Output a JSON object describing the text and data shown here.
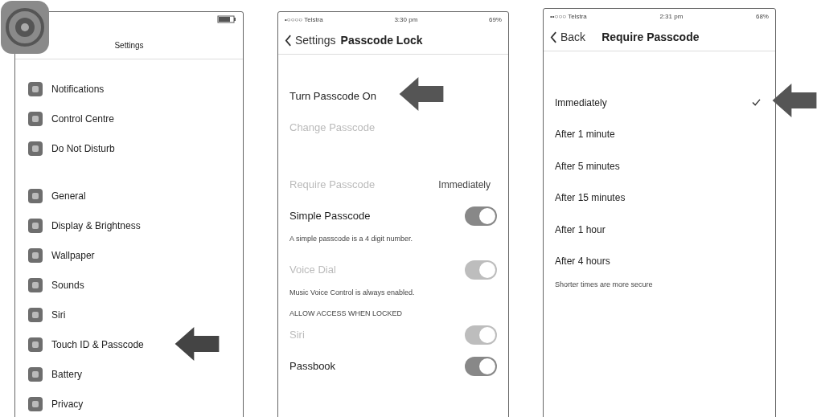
{
  "settings_screen": {
    "title": "Settings",
    "groups": [
      {
        "items": [
          {
            "label": "Notifications",
            "pointer": false
          },
          {
            "label": "Control Centre",
            "pointer": false
          },
          {
            "label": "Do Not Disturb",
            "pointer": false
          }
        ]
      },
      {
        "items": [
          {
            "label": "General",
            "pointer": false
          },
          {
            "label": "Display & Brightness",
            "pointer": false
          },
          {
            "label": "Wallpaper",
            "pointer": false
          },
          {
            "label": "Sounds",
            "pointer": false
          },
          {
            "label": "Siri",
            "pointer": false
          },
          {
            "label": "Touch ID & Passcode",
            "pointer": true
          },
          {
            "label": "Battery",
            "pointer": false
          },
          {
            "label": "Privacy",
            "pointer": false
          }
        ]
      }
    ]
  },
  "passcode_screen": {
    "status": {
      "carrier": "•○○○○ Telstra",
      "time": "3:30 pm",
      "battery": "69%"
    },
    "back": "Settings",
    "title": "Passcode Lock",
    "rows": [
      {
        "kind": "action",
        "label": "Turn Passcode On",
        "disabled": false,
        "pointer": true
      },
      {
        "kind": "action",
        "label": "Change Passcode",
        "disabled": true,
        "pointer": false
      },
      {
        "kind": "gap"
      },
      {
        "kind": "value",
        "label": "Require Passcode",
        "value": "Immediately",
        "disabled": true
      },
      {
        "kind": "toggle",
        "label": "Simple Passcode",
        "on": true,
        "disabled": false
      },
      {
        "kind": "note",
        "label": "A simple passcode is a 4 digit number."
      },
      {
        "kind": "toggle",
        "label": "Voice Dial",
        "on": true,
        "disabled": true
      },
      {
        "kind": "note",
        "label": "Music Voice Control is always enabled."
      },
      {
        "kind": "header",
        "label": "ALLOW ACCESS WHEN LOCKED"
      },
      {
        "kind": "toggle",
        "label": "Siri",
        "on": true,
        "disabled": true
      },
      {
        "kind": "toggle",
        "label": "Passbook",
        "on": true,
        "disabled": false
      }
    ]
  },
  "require_screen": {
    "status": {
      "carrier": "••○○○ Telstra",
      "time": "2:31 pm",
      "battery": "68%"
    },
    "back": "Back",
    "title": "Require Passcode",
    "options": [
      {
        "label": "Immediately",
        "selected": true,
        "pointer": true
      },
      {
        "label": "After 1 minute",
        "selected": false,
        "pointer": false
      },
      {
        "label": "After 5 minutes",
        "selected": false,
        "pointer": false
      },
      {
        "label": "After 15 minutes",
        "selected": false,
        "pointer": false
      },
      {
        "label": "After 1 hour",
        "selected": false,
        "pointer": false
      },
      {
        "label": "After 4 hours",
        "selected": false,
        "pointer": false
      }
    ],
    "footer": "Shorter times are more secure"
  }
}
